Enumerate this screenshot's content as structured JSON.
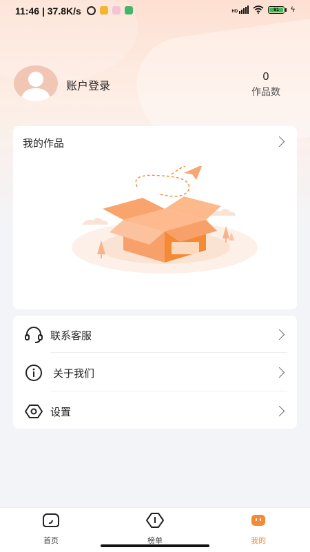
{
  "status_bar": {
    "time": "11:46",
    "net_speed": "| 37.8K/s",
    "battery": "91",
    "network_tag": "HD"
  },
  "profile": {
    "login_label": "账户登录",
    "works_count": "0",
    "works_count_label": "作品数"
  },
  "works_card": {
    "title": "我的作品",
    "illustration_icon": "empty-box-icon"
  },
  "menu": {
    "items": [
      {
        "label": "联系客服",
        "icon": "headset-icon"
      },
      {
        "label": "关于我们",
        "icon": "info-icon"
      },
      {
        "label": "设置",
        "icon": "settings-hex-icon"
      }
    ]
  },
  "bottom_nav": {
    "items": [
      {
        "label": "首页",
        "icon": "home-icon"
      },
      {
        "label": "榜单",
        "icon": "rank-icon"
      },
      {
        "label": "我的",
        "icon": "mine-icon"
      }
    ],
    "active_color": "#f58a35"
  },
  "colors": {
    "accent": "#f58a35",
    "header_bg": "#fde0d2",
    "page_bg": "#f3f4f8"
  }
}
